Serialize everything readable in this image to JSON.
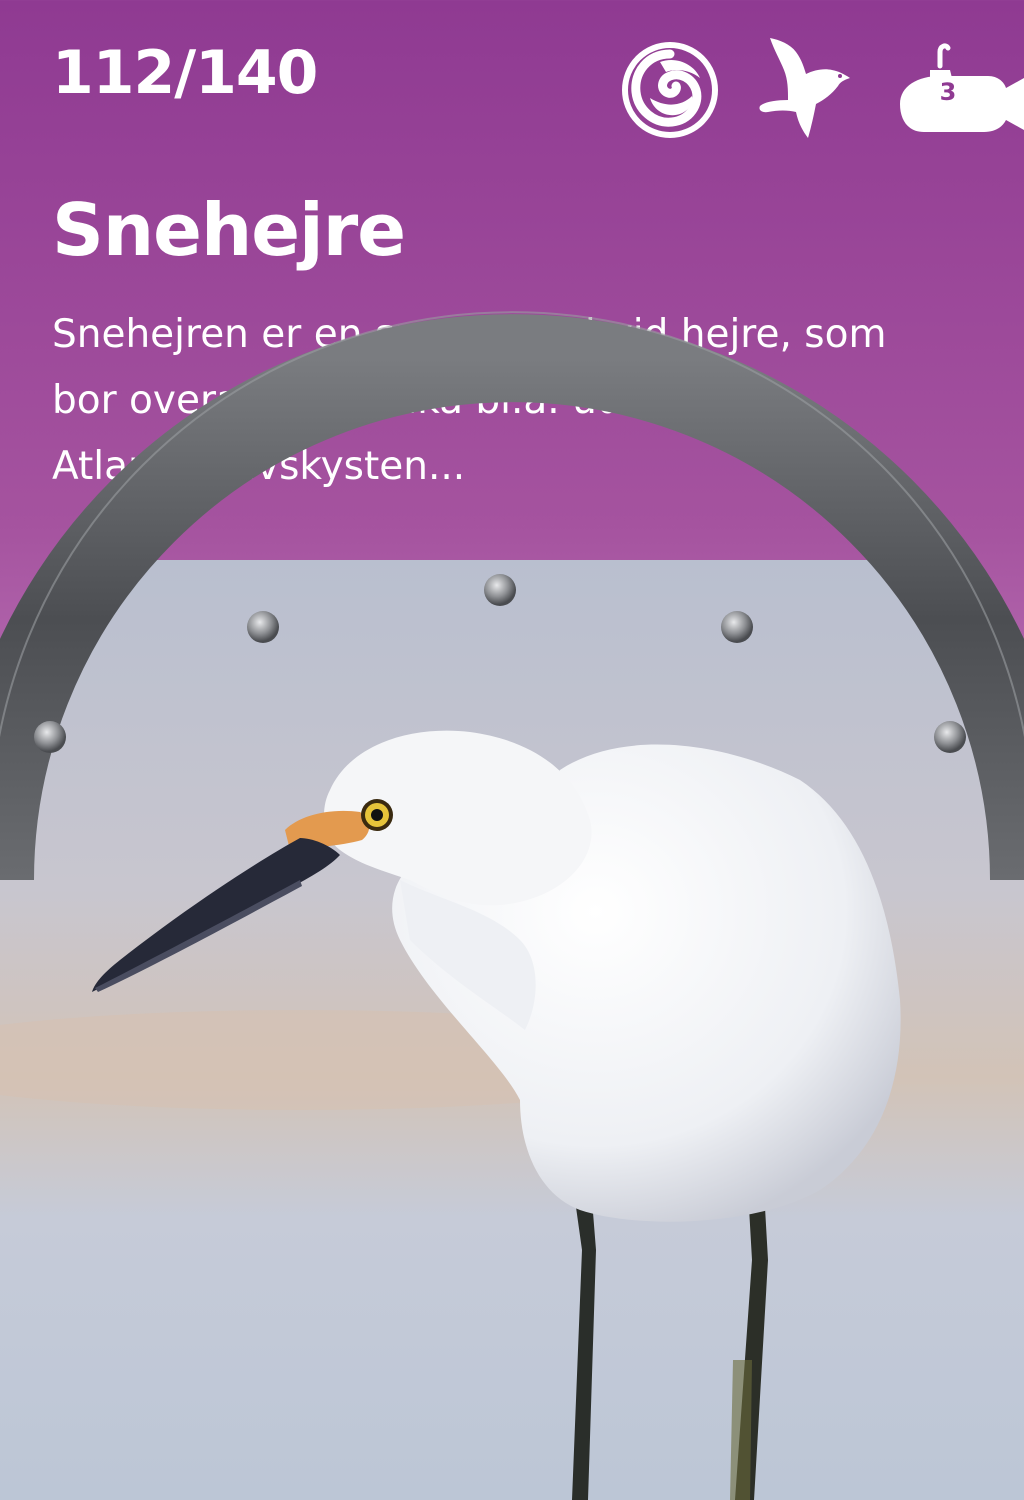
{
  "card": {
    "counter": "112/140",
    "title": "Snehejre",
    "description": "Snehejren er en smuk, lille hvid hejre, som bor overalt i Amerika bl.a. ud til Atlanterhavskysten...",
    "icons": [
      "swirl-icon",
      "bird-icon",
      "submarine-icon"
    ],
    "submarine_level": "3"
  },
  "colors": {
    "background_top": "#8f3a92",
    "background_bottom": "#c07ab9",
    "text": "#ffffff",
    "porthole_ring": "#5a5c5f"
  }
}
